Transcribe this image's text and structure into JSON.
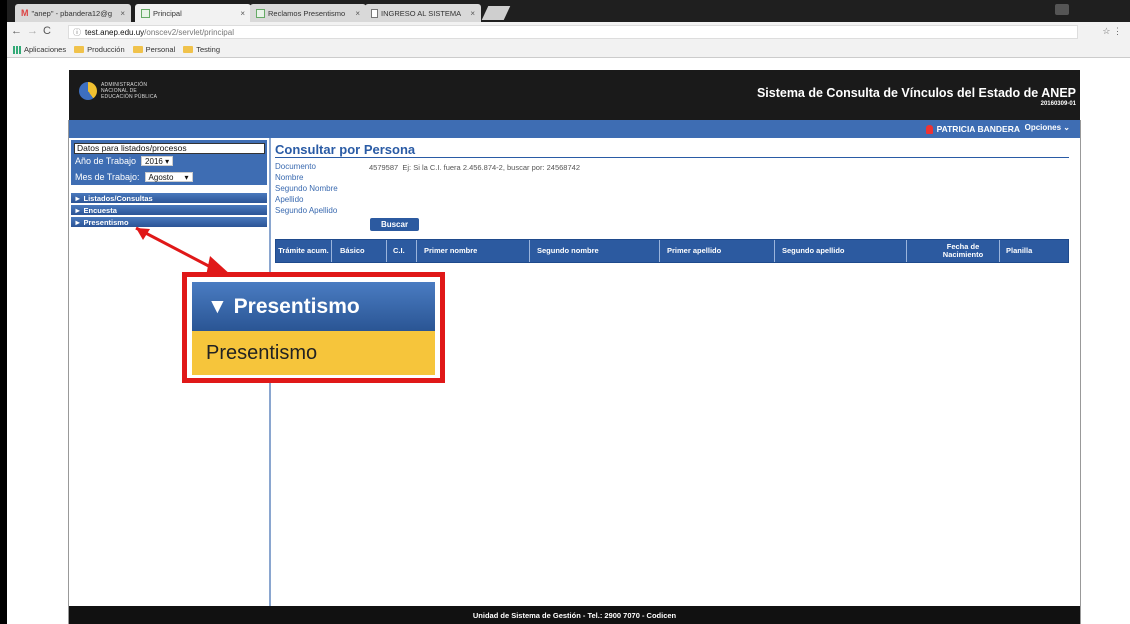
{
  "browser": {
    "tabs": [
      {
        "label": "\"anep\" - pbandera12@g",
        "icon": "gmail-icon"
      },
      {
        "label": "Principal",
        "icon": "page-icon"
      },
      {
        "label": "Reclamos Presentismo",
        "icon": "page-icon"
      },
      {
        "label": "INGRESO AL SISTEMA",
        "icon": "document-icon"
      }
    ],
    "url_host": "test.anep.edu.uy",
    "url_path": "/onscev2/servlet/principal",
    "bookmarks": [
      "Aplicaciones",
      "Producción",
      "Personal",
      "Testing"
    ]
  },
  "header": {
    "logo_lines": [
      "ADMINISTRACIÓN",
      "NACIONAL DE",
      "EDUCACIÓN PÚBLICA"
    ],
    "title": "Sistema de Consulta de Vínculos del Estado de ANEP",
    "version": "20160309-01"
  },
  "userbar": {
    "user": "PATRICIA BANDERA",
    "options": "Opciones"
  },
  "sidebar": {
    "panel_title": "Datos para listados/procesos",
    "year_label": "Año de Trabajo",
    "year_value": "2016",
    "month_label": "Mes de Trabajo:",
    "month_value": "Agosto",
    "menu": [
      "Listados/Consultas",
      "Encuesta",
      "Presentismo"
    ]
  },
  "content": {
    "title": "Consultar por Persona",
    "fields": [
      "Documento",
      "Nombre",
      "Segundo Nombre",
      "Apellido",
      "Segundo Apellido"
    ],
    "document_value": "4579587",
    "document_hint": "Ej: Si la C.I. fuera 2.456.874-2, buscar por: 24568742",
    "search_button": "Buscar",
    "columns": [
      "Trámite acum.",
      "Básico",
      "C.I.",
      "Primer nombre",
      "Segundo nombre",
      "Primer apellido",
      "Segundo apellido",
      "Fecha de Nacimiento",
      "Planilla"
    ]
  },
  "footer": "Unidad de Sistema de Gestión - Tel.: 2900 7070 - Codicen",
  "callout": {
    "header": "Presentismo",
    "item": "Presentismo"
  }
}
